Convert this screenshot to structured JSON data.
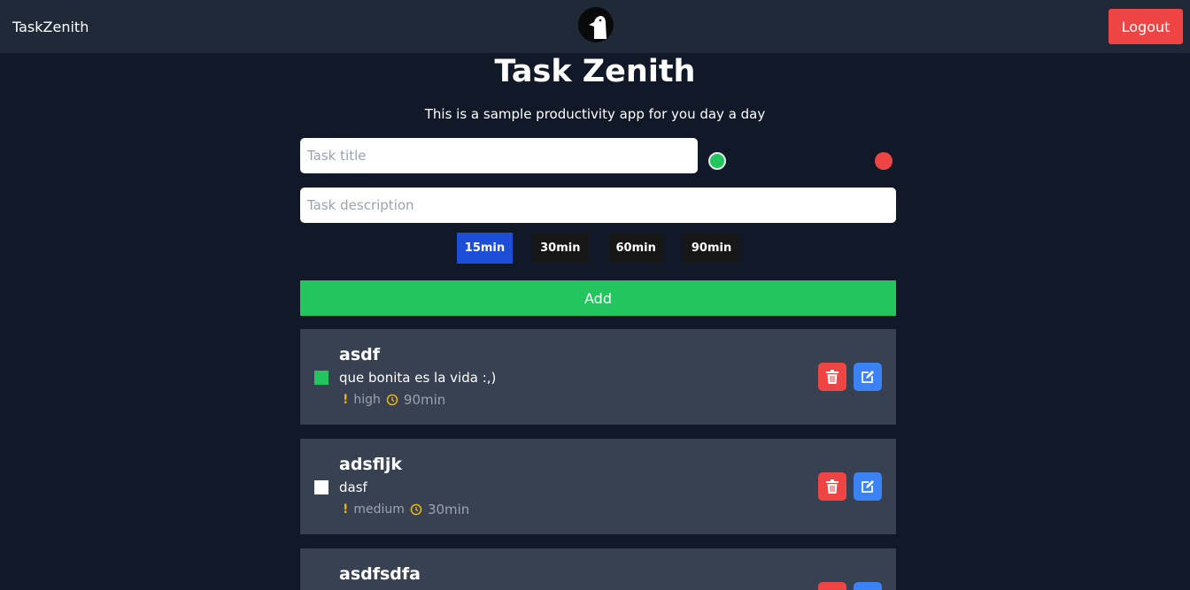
{
  "nav": {
    "brand": "TaskZenith",
    "logout_label": "Logout",
    "logo_icon": "penguin-logo"
  },
  "header": {
    "title": "Task Zenith",
    "subtitle": "This is a sample productivity app for you day a day"
  },
  "form": {
    "title_placeholder": "Task title",
    "title_value": "",
    "description_placeholder": "Task description",
    "description_value": "",
    "priority_dots": [
      {
        "color": "#22c55e",
        "selected": true
      },
      {
        "color": "#ef4444",
        "selected": false
      }
    ],
    "durations": [
      "15min",
      "30min",
      "60min",
      "90min"
    ],
    "selected_duration": "15min",
    "add_label": "Add"
  },
  "tasks": [
    {
      "title": "asdf",
      "description": "que bonita es la vida :,)",
      "priority": "high",
      "duration": "90min",
      "checked": true
    },
    {
      "title": "adsfljk",
      "description": "dasf",
      "priority": "medium",
      "duration": "30min",
      "checked": false
    },
    {
      "title": "asdfsdfa",
      "description": "",
      "priority": "",
      "duration": "",
      "checked": false
    }
  ],
  "colors": {
    "accent_green": "#22c55e",
    "danger": "#ef4444",
    "primary": "#3b82f6",
    "selected_duration": "#1d4ed8",
    "card": "#374151",
    "background": "#111827",
    "nav": "#1f2937",
    "warning": "#eab308"
  }
}
